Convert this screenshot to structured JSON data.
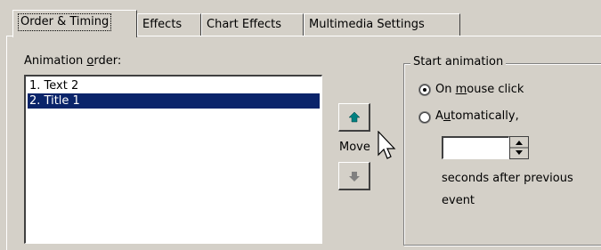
{
  "tabs": [
    {
      "label": "Order & Timing",
      "active": true
    },
    {
      "label": "Effects",
      "active": false
    },
    {
      "label": "Chart Effects",
      "active": false
    },
    {
      "label": "Multimedia Settings",
      "active": false
    }
  ],
  "animation_order": {
    "label_pre": "Animation ",
    "label_key": "o",
    "label_post": "rder:",
    "items": [
      "1. Text 2",
      "2. Title 1"
    ],
    "selected_index": 1
  },
  "move": {
    "label": "Move",
    "up_icon": "arrow-up-icon",
    "down_icon": "arrow-down-icon",
    "up_color": "#008080",
    "down_color": "#808080"
  },
  "start_animation": {
    "legend": "Start animation",
    "on_click": {
      "pre": "On ",
      "key": "m",
      "post": "ouse click",
      "checked": true
    },
    "automatically": {
      "pre": "A",
      "key": "u",
      "post": "tomatically,",
      "checked": false
    },
    "seconds_value": "",
    "seconds_text_1": "seconds after previous",
    "seconds_text_2": "event"
  },
  "colors": {
    "selection": "#0a246a",
    "face": "#d4d0c8"
  }
}
